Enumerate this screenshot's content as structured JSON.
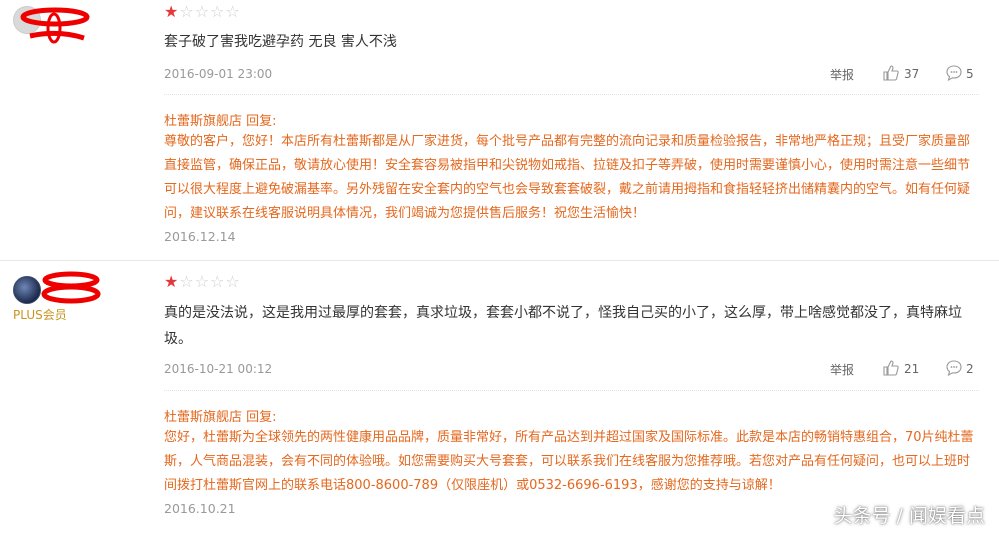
{
  "reviews": [
    {
      "user_label": "",
      "rating": 1,
      "text": "套子破了害我吃避孕药 无良 害人不浅",
      "date": "2016-09-01 23:00",
      "report_label": "举报",
      "likes": "37",
      "comments": "5",
      "reply": {
        "header": "杜蕾斯旗舰店 回复:",
        "text": "尊敬的客户，您好！本店所有杜蕾斯都是从厂家进货，每个批号产品都有完整的流向记录和质量检验报告，非常地严格正规；且受厂家质量部直接监管，确保正品，敬请放心使用！安全套容易被指甲和尖锐物如戒指、拉链及扣子等弄破，使用时需要谨慎小心，使用时需注意一些细节可以很大程度上避免破漏基率。另外残留在安全套内的空气也会导致套套破裂，戴之前请用拇指和食指轻轻挤出储精囊内的空气。如有任何疑问，建议联系在线客服说明具体情况，我们竭诚为您提供售后服务！祝您生活愉快！",
        "date": "2016.12.14"
      }
    },
    {
      "user_label": "PLUS会员",
      "rating": 1,
      "text": "真的是没法说，这是我用过最厚的套套，真求垃圾，套套小都不说了，怪我自己买的小了，这么厚，带上啥感觉都没了，真特麻垃圾。",
      "date": "2016-10-21 00:12",
      "report_label": "举报",
      "likes": "21",
      "comments": "2",
      "reply": {
        "header": "杜蕾斯旗舰店 回复:",
        "text": "您好，杜蕾斯为全球领先的两性健康用品品牌，质量非常好，所有产品达到并超过国家及国际标准。此款是本店的畅销特惠组合，70片纯杜蕾斯，人气商品混装，会有不同的体验哦。如您需要购买大号套套，可以联系我们在线客服为您推荐哦。若您对产品有任何疑问，也可以上班时间拨打杜蕾斯官网上的联系电话800-8600-789（仅限座机）或0532-6696-6193，感谢您的支持与谅解！",
        "date": "2016.10.21"
      }
    }
  ],
  "watermark": "头条号 / 闻娱看点",
  "colors": {
    "star_on": "#e4393c",
    "reply_text": "#e4681e",
    "plus": "#c8941e"
  }
}
